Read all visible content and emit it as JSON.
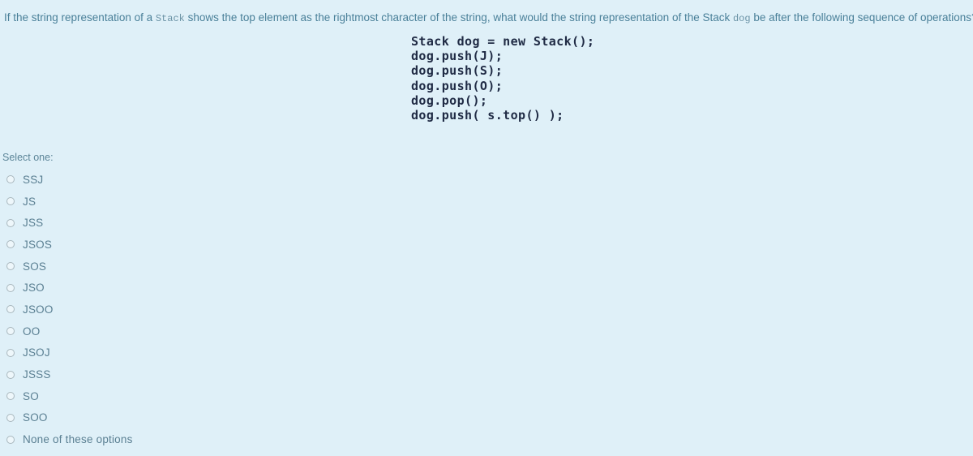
{
  "background_color": "#dff0f8",
  "question": {
    "part1": "If the string representation of a ",
    "mono1": "Stack",
    "part2": " shows the top element as the rightmost character of the string, what would the string representation of the Stack ",
    "mono2": "dog",
    "part3": " be after the following sequence of operations?"
  },
  "code": {
    "lines": [
      "Stack dog = new Stack();",
      "dog.push(J);",
      "dog.push(S);",
      "dog.push(O);",
      "dog.pop();",
      "dog.push( s.top() );"
    ]
  },
  "answers": {
    "select_label": "Select one:",
    "options": [
      {
        "label": "SSJ",
        "selected": false
      },
      {
        "label": "JS",
        "selected": false
      },
      {
        "label": "JSS",
        "selected": false
      },
      {
        "label": "JSOS",
        "selected": false
      },
      {
        "label": "SOS",
        "selected": false
      },
      {
        "label": "JSO",
        "selected": false
      },
      {
        "label": "JSOO",
        "selected": false
      },
      {
        "label": "OO",
        "selected": false
      },
      {
        "label": "JSOJ",
        "selected": false
      },
      {
        "label": "JSSS",
        "selected": false
      },
      {
        "label": "SO",
        "selected": false
      },
      {
        "label": "SOO",
        "selected": false
      },
      {
        "label": "None of these options",
        "selected": false
      }
    ]
  },
  "colors": {
    "question_text": "#4a8099",
    "code_text": "#1f2a44",
    "option_text": "#5a7f92",
    "radio_border": "#a9b7bd"
  }
}
